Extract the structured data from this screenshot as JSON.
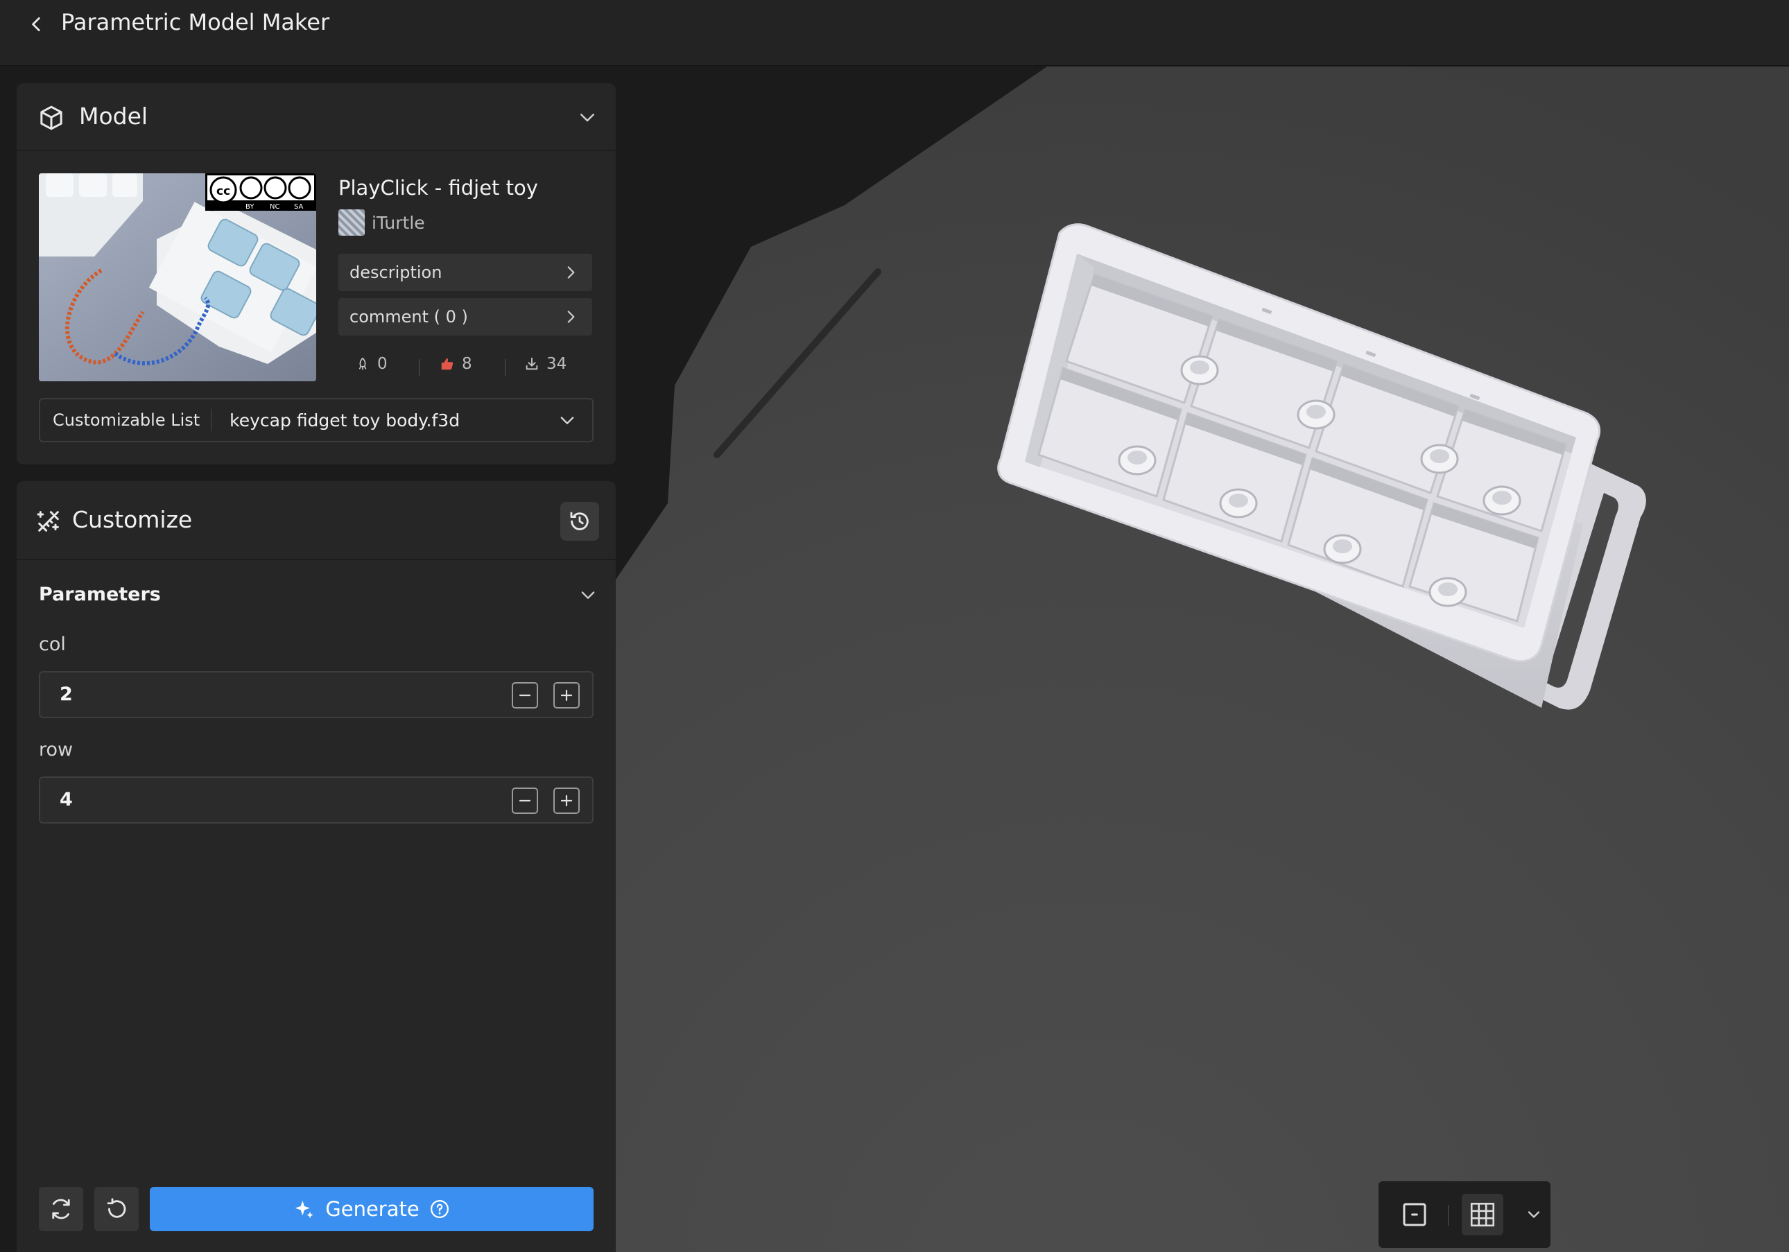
{
  "app": {
    "title": "Parametric Model Maker"
  },
  "model_panel": {
    "title": "Model",
    "model_name": "PlayClick - fidjet toy",
    "author": "iTurtle",
    "description_label": "description",
    "comment_label": "comment ( 0 )",
    "stats": {
      "boosts": "0",
      "likes": "8",
      "downloads": "34"
    },
    "license_badges": [
      "BY",
      "NC",
      "SA"
    ],
    "customizable_list": {
      "label": "Customizable List",
      "value": "keycap fidget toy body.f3d"
    }
  },
  "customize_panel": {
    "title": "Customize",
    "parameters_heading": "Parameters",
    "params": [
      {
        "label": "col",
        "value": "2"
      },
      {
        "label": "row",
        "value": "4"
      }
    ],
    "generate_label": "Generate"
  },
  "colors": {
    "accent": "#3b8ff0",
    "panel": "#262626",
    "viewport_plate": "#454545",
    "model": "#e4e4ea"
  },
  "icons": {
    "back": "chevron-left-icon",
    "model": "cube-icon",
    "customize": "wand-ruler-icon",
    "history": "history-icon",
    "refresh": "refresh-icon",
    "undo": "undo-icon",
    "generate": "sparkle-icon",
    "help": "help-circle-icon",
    "frame": "frame-icon",
    "grid": "grid-icon"
  }
}
